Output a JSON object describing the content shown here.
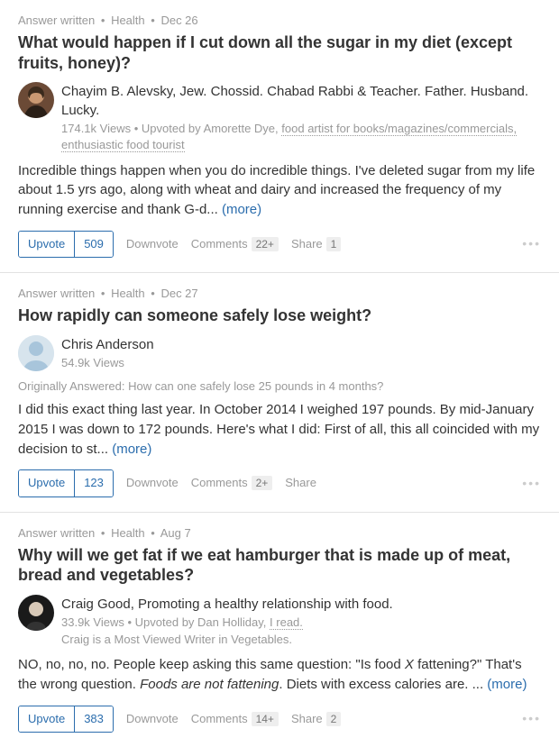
{
  "ui": {
    "answer_written": "Answer written",
    "upvote_label": "Upvote",
    "downvote_label": "Downvote",
    "comments_label": "Comments",
    "share_label": "Share",
    "more_label": "(more)",
    "upvoted_by": "Upvoted by",
    "originally_answered": "Originally Answered:"
  },
  "posts": [
    {
      "topic": "Health",
      "date": "Dec 26",
      "title": "What would happen if I cut down all the sugar in my diet (except fruits, honey)?",
      "author_name": "Chayim B. Alevsky",
      "author_cred": ", Jew. Chossid. Chabad Rabbi & Teacher. Father. Husband. Lucky.",
      "views": "174.1k Views",
      "upvoter_name": "Amorette Dye",
      "upvoter_cred": "food artist for books/magazines/commercials, enthusiastic food tourist",
      "body": "Incredible things happen when you do incredible things. I've deleted sugar from my life about 1.5 yrs ago, along with wheat and dairy and increased the frequency of my running exercise and thank G-d... ",
      "upvotes": "509",
      "comments": "22+",
      "shares": "1"
    },
    {
      "topic": "Health",
      "date": "Dec 27",
      "title": "How rapidly can someone safely lose weight?",
      "author_name": "Chris Anderson",
      "views": "54.9k Views",
      "original_q": "How can one safely lose 25 pounds in 4 months?",
      "body": "I did this exact thing last year.  In October 2014 I weighed 197 pounds.  By mid-January 2015 I was down to 172 pounds.  Here's what I did:   First of all, this all coincided with my decision to st... ",
      "upvotes": "123",
      "comments": "2+"
    },
    {
      "topic": "Health",
      "date": "Aug 7",
      "title": "Why will we get fat if we eat hamburger that is made up of meat, bread and vegetables?",
      "author_name": "Craig Good",
      "author_cred": ", Promoting a healthy relationship with food.",
      "views": "33.9k Views",
      "upvoter_name": "Dan Holliday",
      "upvoter_cred": "I read.",
      "writer_badge": "Craig is a Most Viewed Writer in Vegetables.",
      "body_html": "NO, no, no, no. People keep asking this same question: \"Is food <em>X</em> fattening?\" That's the wrong question. <em>Foods are not fattening</em>. Diets with excess calories are. ... ",
      "upvotes": "383",
      "comments": "14+",
      "shares": "2"
    }
  ]
}
